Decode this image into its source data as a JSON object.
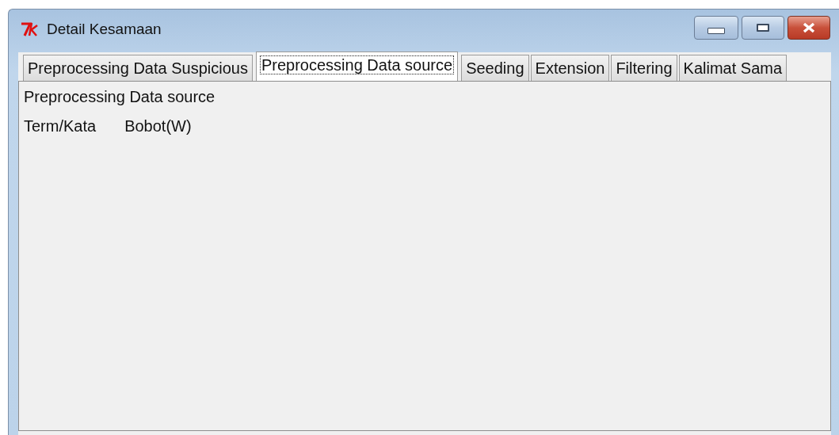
{
  "window": {
    "title": "Detail Kesamaan"
  },
  "tabs": [
    {
      "label": "Preprocessing Data Suspicious",
      "selected": false
    },
    {
      "label": "Preprocessing Data source",
      "selected": true
    },
    {
      "label": "Seeding",
      "selected": false
    },
    {
      "label": "Extension",
      "selected": false
    },
    {
      "label": "Filtering",
      "selected": false
    },
    {
      "label": "Kalimat Sama",
      "selected": false
    }
  ],
  "panel": {
    "heading": "Preprocessing Data source",
    "columns": [
      "Term/Kata",
      "Bobot(W)"
    ]
  }
}
